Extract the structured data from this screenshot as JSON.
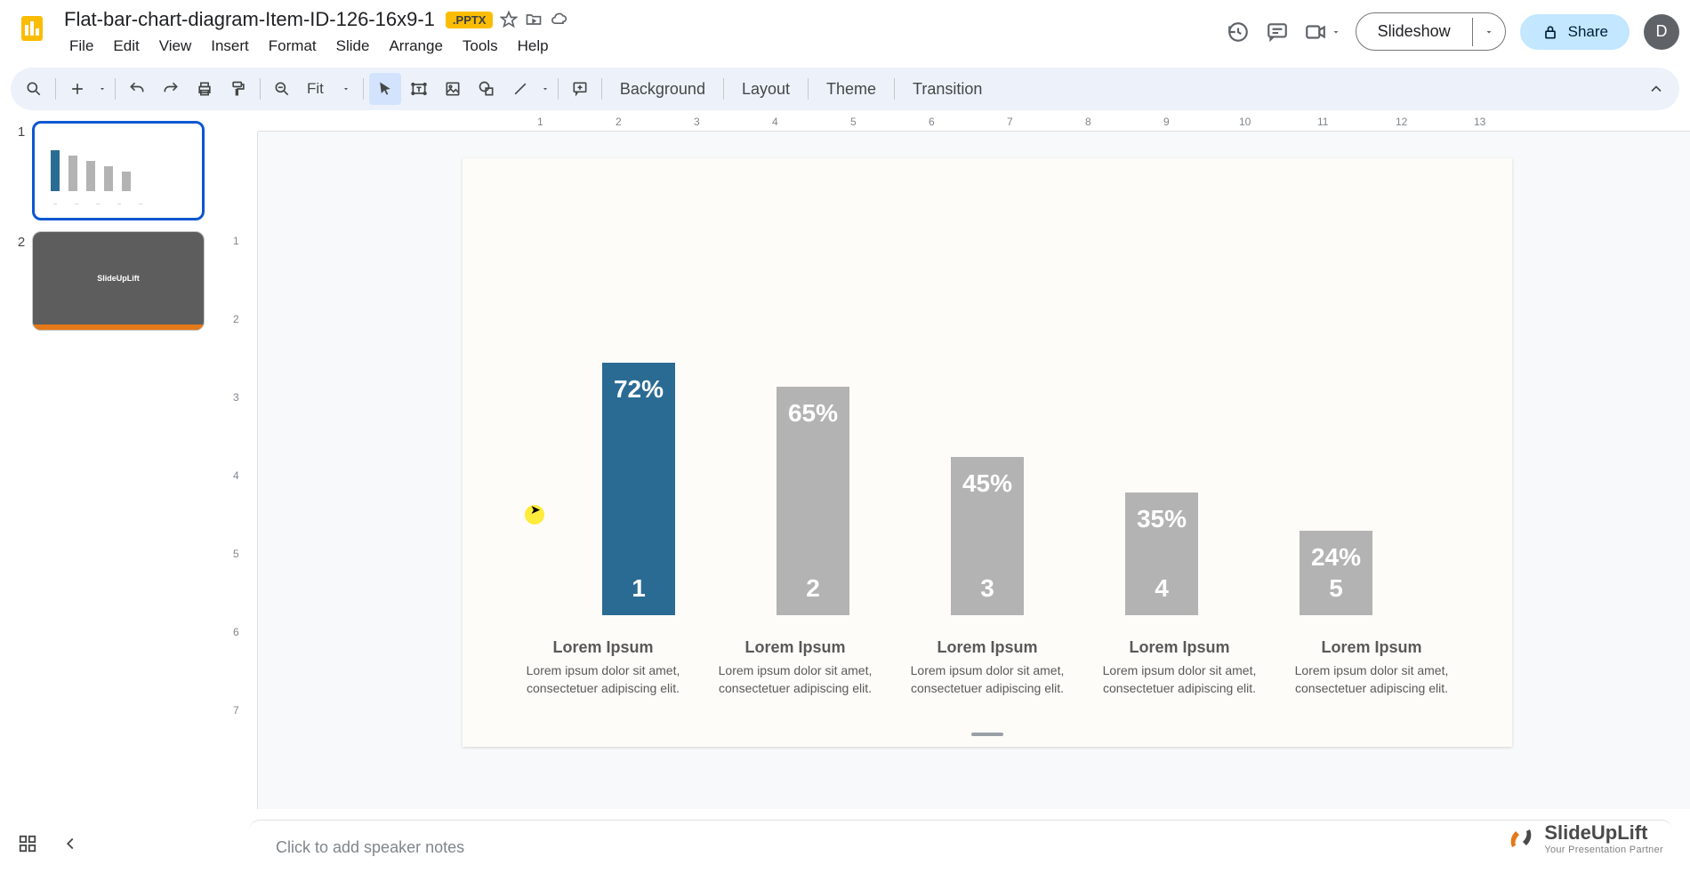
{
  "header": {
    "doc_title": "Flat-bar-chart-diagram-Item-ID-126-16x9-1",
    "badge": ".PPTX",
    "menus": [
      "File",
      "Edit",
      "View",
      "Insert",
      "Format",
      "Slide",
      "Arrange",
      "Tools",
      "Help"
    ],
    "slideshow_label": "Slideshow",
    "share_label": "Share",
    "avatar_letter": "D"
  },
  "toolbar": {
    "zoom_value": "Fit",
    "background_label": "Background",
    "layout_label": "Layout",
    "theme_label": "Theme",
    "transition_label": "Transition"
  },
  "slides": {
    "nums": [
      "1",
      "2"
    ],
    "thumb2_text": "SlideUpLift"
  },
  "chart_data": {
    "type": "bar",
    "categories": [
      "1",
      "2",
      "3",
      "4",
      "5"
    ],
    "values": [
      72,
      65,
      45,
      35,
      24
    ],
    "value_labels": [
      "72%",
      "65%",
      "45%",
      "35%",
      "24%"
    ],
    "highlighted_index": 0,
    "bar_colors": {
      "highlighted": "#2a6b93",
      "normal": "#b3b3b3"
    },
    "ylim": [
      0,
      100
    ]
  },
  "labels": [
    {
      "title": "Lorem Ipsum",
      "text": "Lorem ipsum dolor sit amet, consectetuer adipiscing elit."
    },
    {
      "title": "Lorem Ipsum",
      "text": "Lorem ipsum dolor sit amet, consectetuer adipiscing elit."
    },
    {
      "title": "Lorem Ipsum",
      "text": "Lorem ipsum dolor sit amet, consectetuer adipiscing elit."
    },
    {
      "title": "Lorem Ipsum",
      "text": "Lorem ipsum dolor sit amet, consectetuer adipiscing elit."
    },
    {
      "title": "Lorem Ipsum",
      "text": "Lorem ipsum dolor sit amet, consectetuer adipiscing elit."
    }
  ],
  "ruler_h": [
    "1",
    "2",
    "3",
    "4",
    "5",
    "6",
    "7",
    "8",
    "9",
    "10",
    "11",
    "12",
    "13"
  ],
  "ruler_v": [
    "1",
    "2",
    "3",
    "4",
    "5",
    "6",
    "7"
  ],
  "speaker_notes_placeholder": "Click to add speaker notes",
  "watermark": {
    "brand": "SlideUpLift",
    "tagline": "Your Presentation Partner"
  }
}
